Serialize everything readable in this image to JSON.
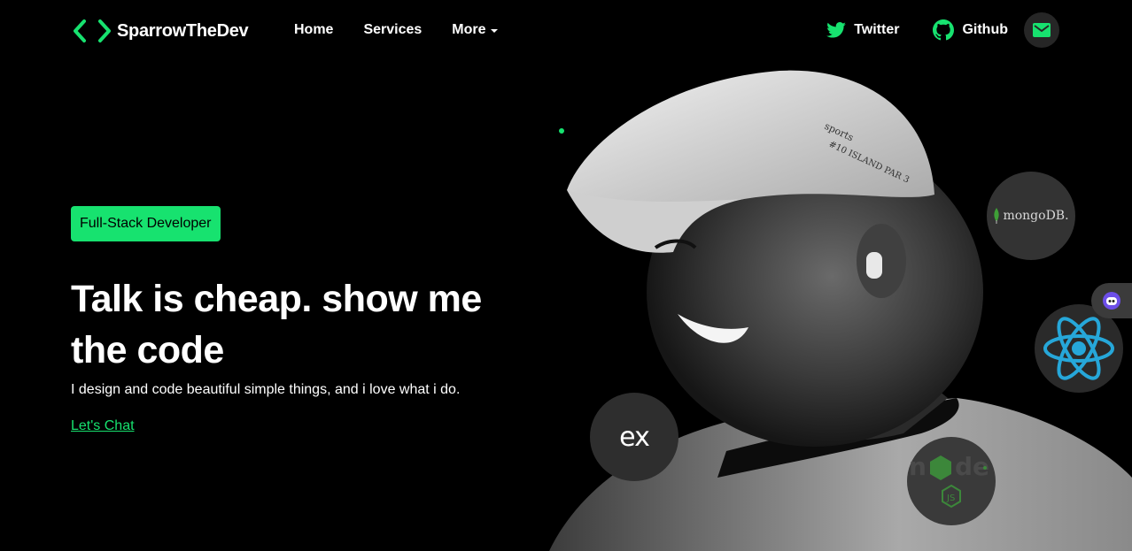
{
  "brand": {
    "name": "SparrowTheDev",
    "icon": "code-brackets-icon",
    "accent": "#17e26f"
  },
  "nav": {
    "links": [
      {
        "label": "Home"
      },
      {
        "label": "Services"
      },
      {
        "label": "More",
        "dropdown": true
      }
    ]
  },
  "social": {
    "twitter": {
      "label": "Twitter",
      "icon": "twitter-icon"
    },
    "github": {
      "label": "Github",
      "icon": "github-icon"
    },
    "mail": {
      "icon": "mail-icon"
    }
  },
  "hero": {
    "badge": "Full-Stack Developer",
    "headline": "Talk is cheap. show me the code",
    "subtext": "I design and code beautiful simple things, and i love what i do.",
    "cta": "Let's Chat"
  },
  "tech_badges": {
    "mongo": {
      "label": "mongoDB.",
      "icon": "mongodb-leaf-icon"
    },
    "react": {
      "icon": "react-icon"
    },
    "express": {
      "label": "ex",
      "icon": "express-icon"
    },
    "node": {
      "icon": "nodejs-icon"
    }
  },
  "colors": {
    "background": "#000000",
    "accent": "#17e26f",
    "react": "#26a7d9",
    "node": "#3c873a"
  }
}
